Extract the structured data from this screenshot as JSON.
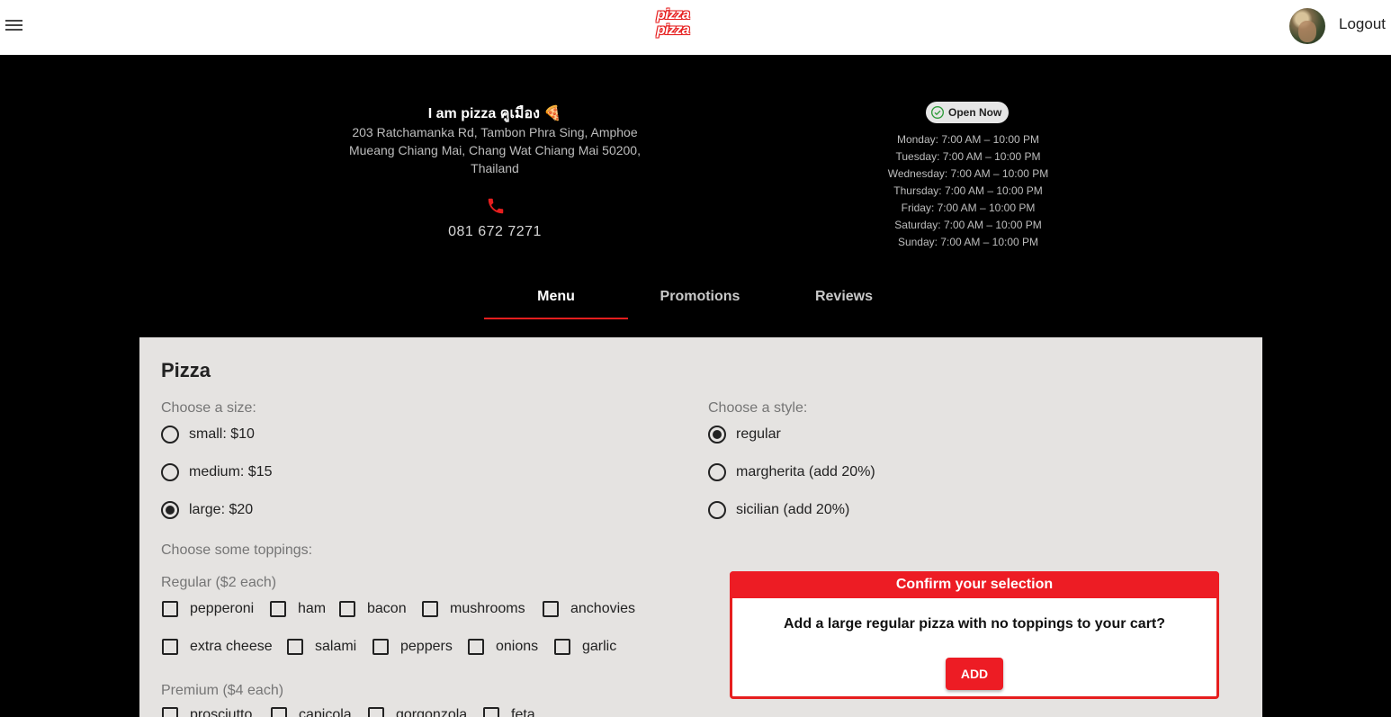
{
  "appbar": {
    "logo_line1": "pizza",
    "logo_line2": "pizza",
    "logout": "Logout"
  },
  "store": {
    "name": "I am pizza คูเมือง 🍕",
    "address": "203 Ratchamanka Rd, Tambon Phra Sing, Amphoe Mueang Chiang Mai, Chang Wat Chiang Mai 50200, Thailand",
    "phone": "081 672 7271",
    "status": "Open Now",
    "hours": [
      "Monday: 7:00 AM – 10:00 PM",
      "Tuesday: 7:00 AM – 10:00 PM",
      "Wednesday: 7:00 AM – 10:00 PM",
      "Thursday: 7:00 AM – 10:00 PM",
      "Friday: 7:00 AM – 10:00 PM",
      "Saturday: 7:00 AM – 10:00 PM",
      "Sunday: 7:00 AM – 10:00 PM"
    ]
  },
  "tabs": [
    "Menu",
    "Promotions",
    "Reviews"
  ],
  "active_tab": "Menu",
  "menu": {
    "title": "Pizza",
    "size_label": "Choose a size:",
    "sizes": [
      "small: $10",
      "medium: $15",
      "large: $20"
    ],
    "selected_size": "large: $20",
    "style_label": "Choose a style:",
    "styles": [
      "regular",
      "margherita (add 20%)",
      "sicilian (add 20%)"
    ],
    "selected_style": "regular",
    "toppings_label": "Choose some toppings:",
    "regular_label": "Regular ($2 each)",
    "regular_toppings": [
      "pepperoni",
      "ham",
      "bacon",
      "mushrooms",
      "anchovies",
      "extra cheese",
      "salami",
      "peppers",
      "onions",
      "garlic"
    ],
    "premium_label": "Premium ($4 each)",
    "premium_toppings": [
      "prosciutto",
      "capicola",
      "gorgonzola",
      "feta"
    ]
  },
  "confirm": {
    "title": "Confirm your selection",
    "message": "Add a large regular pizza with no toppings to your cart?",
    "add": "ADD"
  },
  "colors": {
    "accent": "#e61e1e",
    "header_bg": "#000000",
    "card_bg": "#e5e3e1"
  }
}
